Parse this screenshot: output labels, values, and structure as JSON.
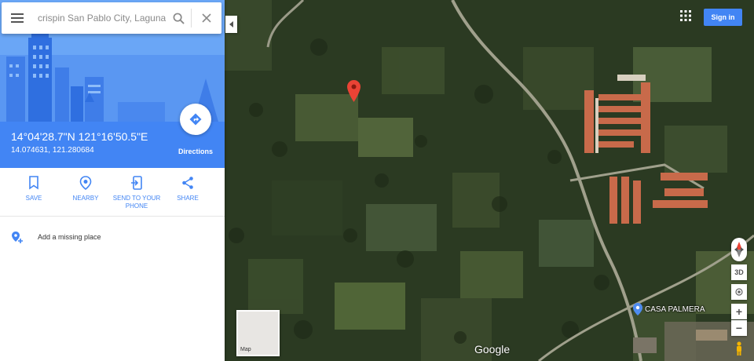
{
  "search": {
    "value": "crispin San Pablo City, Laguna"
  },
  "place": {
    "coordinates_dms": "14°04'28.7\"N 121°16'50.5\"E",
    "coordinates_decimal": "14.074631, 121.280684",
    "directions_label": "Directions"
  },
  "actions": [
    {
      "label": "SAVE",
      "icon": "bookmark-icon"
    },
    {
      "label": "NEARBY",
      "icon": "nearby-icon"
    },
    {
      "label": "SEND TO YOUR PHONE",
      "icon": "send-to-phone-icon"
    },
    {
      "label": "SHARE",
      "icon": "share-icon"
    }
  ],
  "missing_place": {
    "label": "Add a missing place",
    "icon": "add-place-icon"
  },
  "header": {
    "signin_label": "Sign in",
    "apps_icon": "apps-grid-icon"
  },
  "controls": {
    "three_d_label": "3D",
    "zoom_in": "+",
    "zoom_out": "−"
  },
  "minimap": {
    "label": "Map"
  },
  "map": {
    "brand": "Google",
    "poi_label": "CASA PALMERA",
    "pin_color": "#ea4335"
  },
  "colors": {
    "accent": "#4285f4",
    "signin": "#4285f4"
  }
}
